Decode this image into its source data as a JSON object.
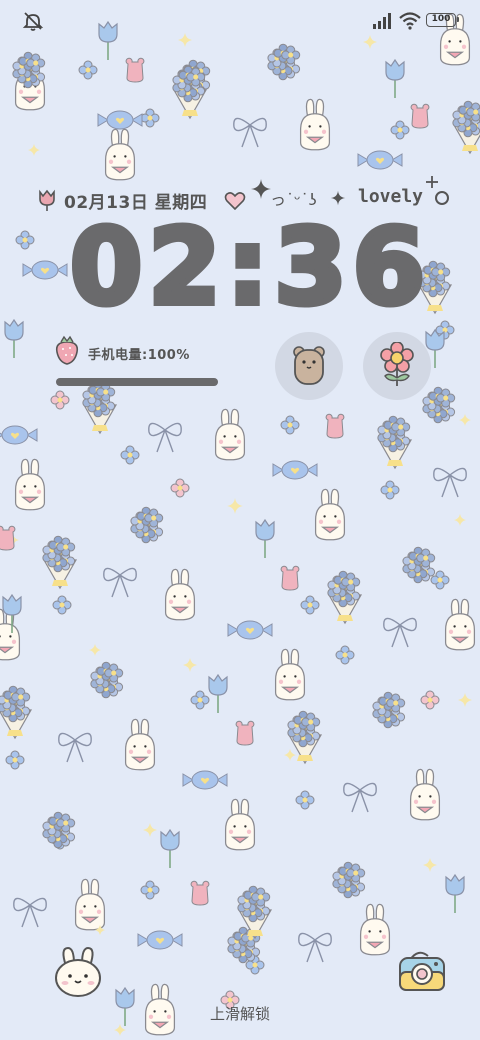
{
  "status_bar": {
    "battery_level": "100",
    "icons": [
      "mute-icon",
      "signal-icon",
      "wifi-icon",
      "battery-icon"
    ]
  },
  "lockscreen": {
    "date": "02月13日 星期四",
    "kaomoji": "っ˙ᵕ˙ʖ",
    "lovely": "lovely",
    "time": "02:36",
    "battery_label": "手机电量:100%",
    "battery_fraction": 1.0,
    "unlock_hint": "上滑解锁"
  },
  "shortcuts": {
    "left_icon": "bear-icon",
    "right_icon": "flower-icon",
    "bottom_left": "bunny-face-icon",
    "bottom_right": "camera-icon"
  },
  "colors": {
    "background": "#e3eaf7",
    "text": "#6a6a6c"
  }
}
